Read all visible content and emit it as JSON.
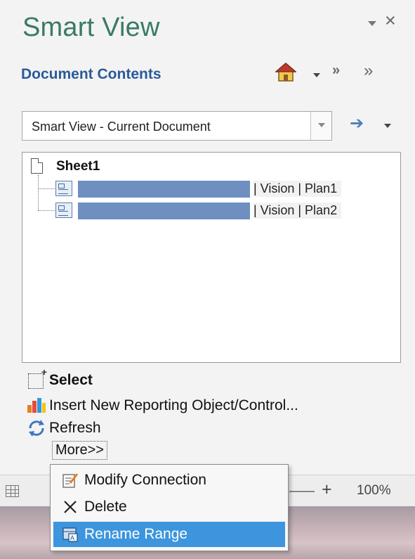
{
  "panel": {
    "title": "Smart View"
  },
  "header": {
    "title": "Document Contents",
    "icons": [
      "home-icon",
      "dropdown-icon",
      "double-chevron-down-icon",
      "double-chevron-right-icon"
    ]
  },
  "connection_select": {
    "value": "Smart View - Current Document"
  },
  "tree": {
    "root_label": "Sheet1",
    "items": [
      {
        "label": "| Vision | Plan1"
      },
      {
        "label": "| Vision | Plan2"
      }
    ]
  },
  "actions": {
    "select_label": "Select",
    "insert_label": "Insert New Reporting Object/Control...",
    "refresh_label": "Refresh",
    "more_label": "More>>"
  },
  "context_menu": {
    "items": [
      {
        "label": "Modify Connection",
        "icon": "edit-connection-icon"
      },
      {
        "label": "Delete",
        "icon": "x-delete-icon"
      },
      {
        "label": "Rename Range",
        "icon": "rename-range-icon",
        "highlighted": true
      }
    ]
  },
  "statusbar": {
    "zoom": "100%"
  },
  "colors": {
    "title_green": "#3a7a63",
    "header_blue": "#2a5a9a",
    "range_bar": "#6e8fbf",
    "menu_highlight": "#3d95dd"
  }
}
